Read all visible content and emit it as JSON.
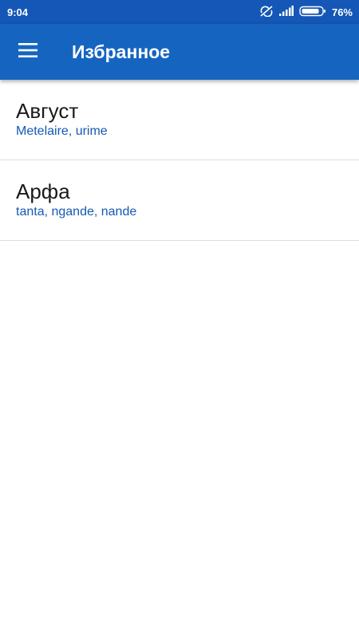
{
  "status_bar": {
    "time": "9:04",
    "battery_percent": "76%",
    "icons": [
      "no-sync-icon",
      "signal-icon",
      "battery-icon"
    ]
  },
  "app_bar": {
    "title": "Избранное",
    "menu_icon": "hamburger-menu-icon"
  },
  "favorites": [
    {
      "word": "Август",
      "translation": "Metelaire, urime"
    },
    {
      "word": "Арфа",
      "translation": "tanta, ngande, nande"
    }
  ],
  "colors": {
    "status_bar": "#1457b6",
    "app_bar": "#1565c0",
    "accent_text": "#1559b3",
    "divider": "#dcdcdc"
  }
}
